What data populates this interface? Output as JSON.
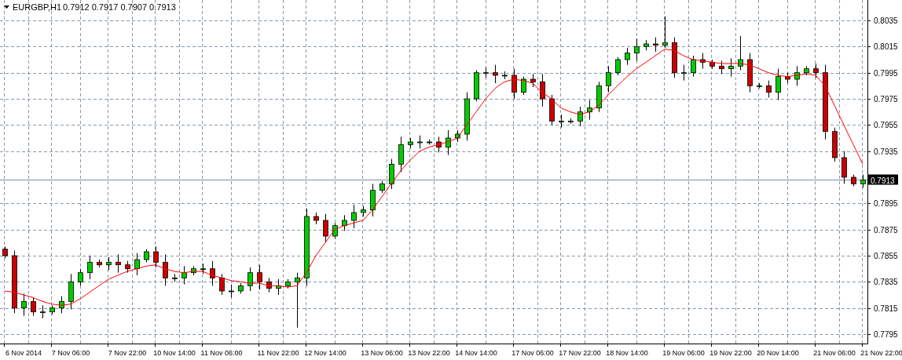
{
  "header": {
    "symbol": "EURGBP,H1",
    "quote": "0.7912 0.7917 0.7907 0.7913"
  },
  "chart": {
    "chart_data": {
      "type": "candlestick",
      "grid": true,
      "ylim": [
        0.77878,
        0.80506
      ],
      "ref_lines": [
        {
          "axis": "y",
          "value": 0.7913,
          "label": "0.7913",
          "color": "#7a8ea8"
        }
      ],
      "categories": [
        null,
        null,
        "6 Nov 2014",
        null,
        null,
        null,
        null,
        "7 Nov 06:00",
        null,
        null,
        null,
        null,
        null,
        "7 Nov 22:00",
        null,
        null,
        null,
        null,
        "10 Nov 14:00",
        null,
        null,
        null,
        null,
        "11 Nov 06:00",
        null,
        null,
        null,
        null,
        null,
        "11 Nov 22:00",
        null,
        null,
        null,
        null,
        "12 Nov 14:00",
        null,
        null,
        null,
        null,
        null,
        "13 Nov 06:00",
        null,
        null,
        null,
        null,
        "13 Nov 22:00",
        null,
        null,
        null,
        null,
        "14 Nov 14:00",
        null,
        null,
        null,
        null,
        null,
        "17 Nov 06:00",
        null,
        null,
        null,
        null,
        "17 Nov 22:00",
        null,
        null,
        null,
        null,
        "18 Nov 14:00",
        null,
        null,
        null,
        null,
        null,
        "19 Nov 06:00",
        null,
        null,
        null,
        null,
        "19 Nov 22:00",
        null,
        null,
        null,
        null,
        "20 Nov 14:00",
        null,
        null,
        null,
        null,
        null,
        "21 Nov 06:00",
        null,
        null,
        null,
        null,
        "21 Nov 22:00"
      ],
      "ohlc": [
        [
          0.786,
          0.7862,
          0.7853,
          0.7855
        ],
        [
          0.7855,
          0.7859,
          0.7811,
          0.7815
        ],
        [
          0.7815,
          0.7826,
          0.7809,
          0.782
        ],
        [
          0.782,
          0.7823,
          0.7809,
          0.7812
        ],
        [
          0.7812,
          0.7817,
          0.7807,
          0.7812
        ],
        [
          0.7812,
          0.7817,
          0.781,
          0.7815
        ],
        [
          0.7815,
          0.7824,
          0.7811,
          0.782
        ],
        [
          0.782,
          0.7841,
          0.7814,
          0.7835
        ],
        [
          0.7835,
          0.7845,
          0.7832,
          0.7842
        ],
        [
          0.7842,
          0.7855,
          0.7837,
          0.785
        ],
        [
          0.785,
          0.7852,
          0.7846,
          0.7848
        ],
        [
          0.7848,
          0.7854,
          0.7844,
          0.785
        ],
        [
          0.785,
          0.7856,
          0.7842,
          0.7848
        ],
        [
          0.7848,
          0.7851,
          0.7842,
          0.7845
        ],
        [
          0.7845,
          0.7857,
          0.784,
          0.7852
        ],
        [
          0.7852,
          0.786,
          0.785,
          0.7858
        ],
        [
          0.7858,
          0.7862,
          0.7846,
          0.785
        ],
        [
          0.785,
          0.7856,
          0.7832,
          0.7838
        ],
        [
          0.7838,
          0.7841,
          0.7835,
          0.7838
        ],
        [
          0.7838,
          0.7847,
          0.7833,
          0.7842
        ],
        [
          0.7842,
          0.7847,
          0.784,
          0.7845
        ],
        [
          0.7845,
          0.7849,
          0.7841,
          0.7845
        ],
        [
          0.7845,
          0.7851,
          0.7832,
          0.7838
        ],
        [
          0.7838,
          0.7841,
          0.7825,
          0.7828
        ],
        [
          0.7828,
          0.7833,
          0.7823,
          0.7828
        ],
        [
          0.7828,
          0.7834,
          0.7826,
          0.7832
        ],
        [
          0.7832,
          0.7846,
          0.7828,
          0.7842
        ],
        [
          0.7842,
          0.7848,
          0.7829,
          0.7835
        ],
        [
          0.7835,
          0.7838,
          0.7827,
          0.783
        ],
        [
          0.783,
          0.7837,
          0.7825,
          0.7832
        ],
        [
          0.7832,
          0.7837,
          0.783,
          0.7835
        ],
        [
          0.7835,
          0.7842,
          0.78,
          0.7838
        ],
        [
          0.7838,
          0.7891,
          0.7832,
          0.7885
        ],
        [
          0.7885,
          0.7888,
          0.7879,
          0.7882
        ],
        [
          0.7882,
          0.7887,
          0.7865,
          0.787
        ],
        [
          0.787,
          0.788,
          0.7868,
          0.7878
        ],
        [
          0.7878,
          0.7886,
          0.7874,
          0.7882
        ],
        [
          0.7882,
          0.7894,
          0.7876,
          0.7888
        ],
        [
          0.7888,
          0.7893,
          0.7885,
          0.789
        ],
        [
          0.789,
          0.791,
          0.7885,
          0.7905
        ],
        [
          0.7905,
          0.7912,
          0.7903,
          0.791
        ],
        [
          0.791,
          0.7929,
          0.7906,
          0.7925
        ],
        [
          0.7925,
          0.7946,
          0.7919,
          0.794
        ],
        [
          0.794,
          0.7945,
          0.7937,
          0.7942
        ],
        [
          0.7942,
          0.7947,
          0.7937,
          0.7942
        ],
        [
          0.7942,
          0.7944,
          0.794,
          0.7942
        ],
        [
          0.7942,
          0.7946,
          0.7934,
          0.7938
        ],
        [
          0.7938,
          0.7951,
          0.7932,
          0.7945
        ],
        [
          0.7945,
          0.7951,
          0.7942,
          0.7948
        ],
        [
          0.7948,
          0.798,
          0.7943,
          0.7975
        ],
        [
          0.7975,
          0.7997,
          0.7973,
          0.7995
        ],
        [
          0.7995,
          0.7999,
          0.7991,
          0.7995
        ],
        [
          0.7995,
          0.8001,
          0.7987,
          0.7993
        ],
        [
          0.7993,
          0.7996,
          0.799,
          0.7993
        ],
        [
          0.7993,
          0.7998,
          0.7975,
          0.798
        ],
        [
          0.798,
          0.7992,
          0.7978,
          0.799
        ],
        [
          0.799,
          0.7994,
          0.7984,
          0.7988
        ],
        [
          0.7988,
          0.7994,
          0.7969,
          0.7975
        ],
        [
          0.7975,
          0.7978,
          0.7955,
          0.7958
        ],
        [
          0.7958,
          0.7963,
          0.7953,
          0.7958
        ],
        [
          0.7958,
          0.796,
          0.7956,
          0.7958
        ],
        [
          0.7958,
          0.7969,
          0.7954,
          0.7965
        ],
        [
          0.7965,
          0.7974,
          0.7959,
          0.7968
        ],
        [
          0.7968,
          0.7988,
          0.7965,
          0.7985
        ],
        [
          0.7985,
          0.8,
          0.798,
          0.7995
        ],
        [
          0.7995,
          0.8007,
          0.7993,
          0.8005
        ],
        [
          0.8005,
          0.8014,
          0.8001,
          0.801
        ],
        [
          0.801,
          0.8021,
          0.8004,
          0.8015
        ],
        [
          0.8015,
          0.802,
          0.8012,
          0.8017
        ],
        [
          0.8017,
          0.8022,
          0.8011,
          0.8016
        ],
        [
          0.8016,
          0.8038,
          0.8014,
          0.8018
        ],
        [
          0.8018,
          0.8022,
          0.7991,
          0.7995
        ],
        [
          0.7995,
          0.8001,
          0.7989,
          0.7995
        ],
        [
          0.7995,
          0.8008,
          0.7992,
          0.8005
        ],
        [
          0.8005,
          0.801,
          0.7998,
          0.8003
        ],
        [
          0.8003,
          0.8005,
          0.7998,
          0.8
        ],
        [
          0.8,
          0.8004,
          0.7994,
          0.7998
        ],
        [
          0.7998,
          0.8006,
          0.7992,
          0.8
        ],
        [
          0.8,
          0.8023,
          0.7997,
          0.8005
        ],
        [
          0.8005,
          0.801,
          0.798,
          0.7985
        ],
        [
          0.7985,
          0.7987,
          0.7983,
          0.7985
        ],
        [
          0.7985,
          0.7989,
          0.7976,
          0.798
        ],
        [
          0.798,
          0.7998,
          0.7974,
          0.7992
        ],
        [
          0.7992,
          0.7995,
          0.7987,
          0.799
        ],
        [
          0.799,
          0.8,
          0.7985,
          0.7995
        ],
        [
          0.7995,
          0.8,
          0.7993,
          0.7998
        ],
        [
          0.7998,
          0.8002,
          0.7991,
          0.7995
        ],
        [
          0.7995,
          0.8001,
          0.7944,
          0.795
        ],
        [
          0.795,
          0.7953,
          0.7927,
          0.793
        ],
        [
          0.793,
          0.7935,
          0.791,
          0.7915
        ],
        [
          0.7915,
          0.7917,
          0.7908,
          0.791
        ],
        [
          0.791,
          0.7917,
          0.7907,
          0.7913
        ],
        null,
        null
      ],
      "series": [
        {
          "color": "#ff0000",
          "values": [
            0.7828,
            0.7827,
            0.7825,
            0.7823,
            0.782,
            0.7818,
            0.7817,
            0.7818,
            0.7822,
            0.7827,
            0.7832,
            0.7837,
            0.784,
            0.7843,
            0.7845,
            0.7847,
            0.7848,
            0.7845,
            0.7843,
            0.7842,
            0.7843,
            0.7843,
            0.784,
            0.7838,
            0.7836,
            0.7835,
            0.7834,
            0.7834,
            0.7832,
            0.7832,
            0.7831,
            0.7832,
            0.7842,
            0.7855,
            0.7865,
            0.7875,
            0.7878,
            0.788,
            0.7882,
            0.789,
            0.79,
            0.791,
            0.792,
            0.7928,
            0.7935,
            0.7938,
            0.794,
            0.7942,
            0.7945,
            0.7955,
            0.7965,
            0.7975,
            0.7983,
            0.7988,
            0.799,
            0.7989,
            0.7987,
            0.798,
            0.7975,
            0.7968,
            0.7965,
            0.7963,
            0.7965,
            0.797,
            0.7978,
            0.7985,
            0.7992,
            0.7998,
            0.8003,
            0.8008,
            0.8013,
            0.8012,
            0.8008,
            0.8005,
            0.8004,
            0.8003,
            0.8002,
            0.8002,
            0.8002,
            0.8001,
            0.7998,
            0.7995,
            0.7993,
            0.7992,
            0.7993,
            0.7994,
            0.7993,
            0.7985,
            0.797,
            0.7955,
            0.794,
            0.7925,
            null,
            null
          ],
          "type": "line"
        }
      ],
      "yticks": [
        0.8035,
        0.8015,
        0.7995,
        0.7975,
        0.7955,
        0.7935,
        0.7895,
        0.7875,
        0.7855,
        0.7835,
        0.7815,
        0.7795
      ]
    }
  }
}
